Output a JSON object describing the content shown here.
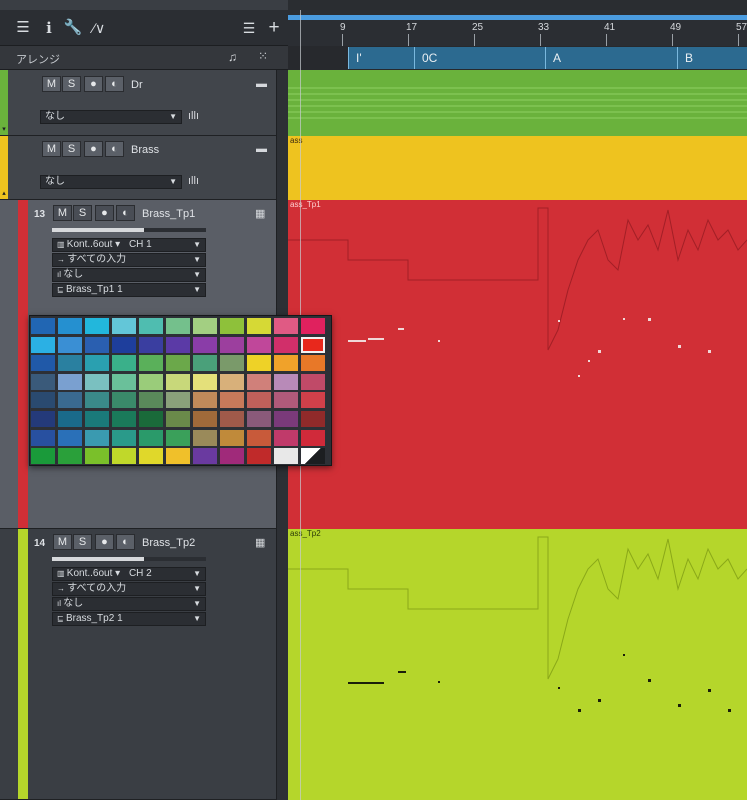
{
  "ruler": {
    "labels": [
      "9",
      "17",
      "25",
      "33",
      "41",
      "49",
      "57"
    ]
  },
  "arrange": {
    "label": "アレンジ"
  },
  "markers": [
    {
      "label": "I'"
    },
    {
      "label": "0C"
    },
    {
      "label": "A"
    },
    {
      "label": "B"
    }
  ],
  "tracks": [
    {
      "num": "",
      "name": "Dr",
      "color": "#6ab23c",
      "buttons": [
        "M",
        "S"
      ],
      "selector": "なし",
      "lane_label": ""
    },
    {
      "num": "",
      "name": "Brass",
      "color": "#eec31f",
      "buttons": [
        "M",
        "S"
      ],
      "selector": "なし",
      "lane_label": "ass"
    },
    {
      "num": "13",
      "name": "Brass_Tp1",
      "color": "#d12f36",
      "buttons": [
        "M",
        "S"
      ],
      "instrument": "Kont..6out",
      "channel": "CH 1",
      "input": "すべての入力",
      "sub": "なし",
      "output": "Brass_Tp1 1",
      "lane_label": "ass_Tp1"
    },
    {
      "num": "14",
      "name": "Brass_Tp2",
      "color": "#b5d62b",
      "buttons": [
        "M",
        "S"
      ],
      "instrument": "Kont..6out",
      "channel": "CH 2",
      "input": "すべての入力",
      "sub": "なし",
      "output": "Brass_Tp2 1",
      "lane_label": "ass_Tp2"
    }
  ],
  "palette": {
    "selected_index": 21,
    "colors": [
      "#2166b3",
      "#2590d0",
      "#22b7dc",
      "#63c6d8",
      "#4fbdb0",
      "#74c08c",
      "#a3cf82",
      "#8ec13a",
      "#d6d935",
      "#e05a84",
      "#e0215e",
      "#2bb0e4",
      "#3a8fd4",
      "#2a5fb0",
      "#1e3e9c",
      "#3a3ea0",
      "#5b3aa6",
      "#8a3da8",
      "#9c3f9e",
      "#c0479a",
      "#d12f6a",
      "#e8281c",
      "#2059a8",
      "#2a80a0",
      "#2aa0b0",
      "#3ab08a",
      "#5ab05a",
      "#6ba84a",
      "#4aa07a",
      "#7a9a6a",
      "#eed227",
      "#f0a22a",
      "#e87828",
      "#3a5a7a",
      "#7aa0d0",
      "#7ac0c0",
      "#6ac09a",
      "#9acc7a",
      "#c8d87a",
      "#e4e07a",
      "#d8b07a",
      "#d0807a",
      "#b88ab8",
      "#c04a68",
      "#2a4a70",
      "#3a6a90",
      "#3a8a8a",
      "#3a8a6a",
      "#5a8a5a",
      "#8aa07a",
      "#c08a5a",
      "#c87a5a",
      "#c0605a",
      "#b05a7a",
      "#d0404a",
      "#243a7a",
      "#1a6a8a",
      "#1a7a7a",
      "#1a7a5a",
      "#1a6a3a",
      "#6a8a4a",
      "#a06a3a",
      "#a05a4a",
      "#8a5a7a",
      "#7a3a7a",
      "#902a2a",
      "#2850a0",
      "#2a70b8",
      "#3a9ab0",
      "#2a9a8a",
      "#2a9a6a",
      "#3aa05a",
      "#9a8a5a",
      "#c08a3a",
      "#c85a3a",
      "#c03a6a",
      "#d02a3a",
      "#1a9a3a",
      "#2aa03a",
      "#7ac02a",
      "#c0d82a",
      "#e0d82a",
      "#f0c02a",
      "#6a3aa0",
      "#a02a7a",
      "#c02a2a",
      "#e8e8e8",
      "#ffffff"
    ]
  },
  "colors": {
    "dr": "#6ab23c",
    "brass": "#eec31f",
    "tp1": "#d12f36",
    "tp2": "#b5d62b",
    "ruler_accent": "#4b9ce0",
    "marker": "#2c6a90"
  }
}
